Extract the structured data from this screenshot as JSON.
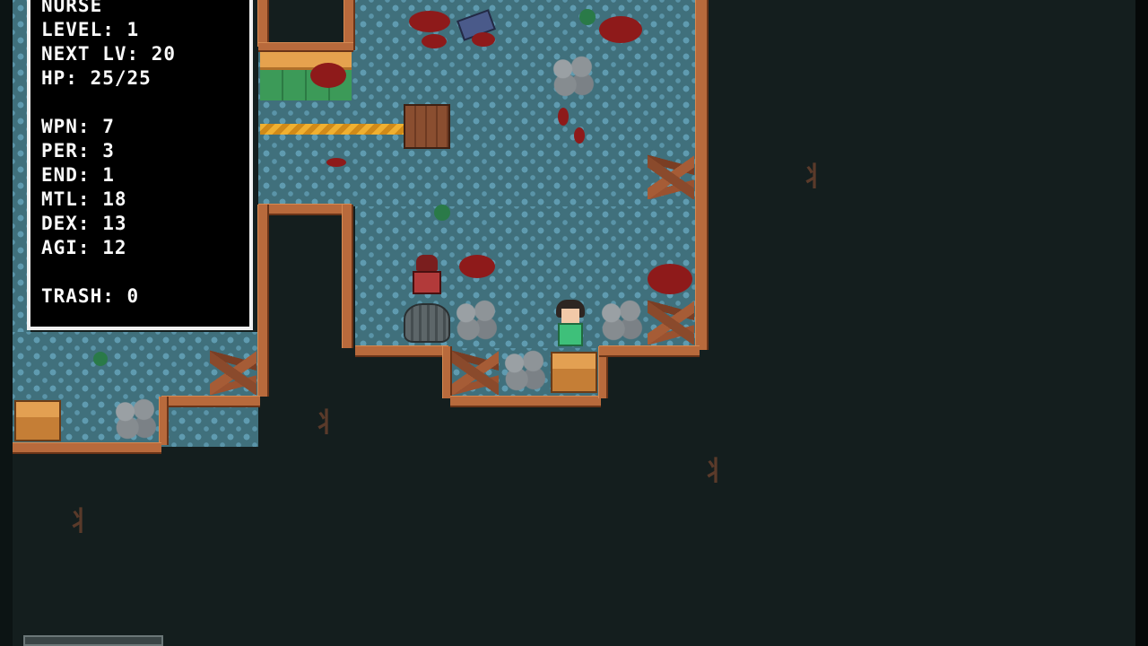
{
  "hud": {
    "class_name": "NURSE",
    "level": "LEVEL: 1",
    "next_level": "NEXT LV: 20",
    "hp": "HP: 25/25",
    "wpn": "WPN: 7",
    "per": "PER: 3",
    "end": "END: 1",
    "mtl": "MTL: 18",
    "dex": "DEX: 13",
    "agi": "AGI: 12",
    "trash": "TRASH: 0"
  },
  "colors": {
    "background": "#141e1e",
    "floor": "#40707c",
    "wall": "#b86a3c",
    "blood": "#8e1a1a",
    "hud_text": "#fafafa"
  },
  "icons": [
    "rock-pile",
    "wood-pile",
    "wooden-crate",
    "cardboard-box",
    "manhole-cover",
    "blood-splatter",
    "claw-mark"
  ]
}
